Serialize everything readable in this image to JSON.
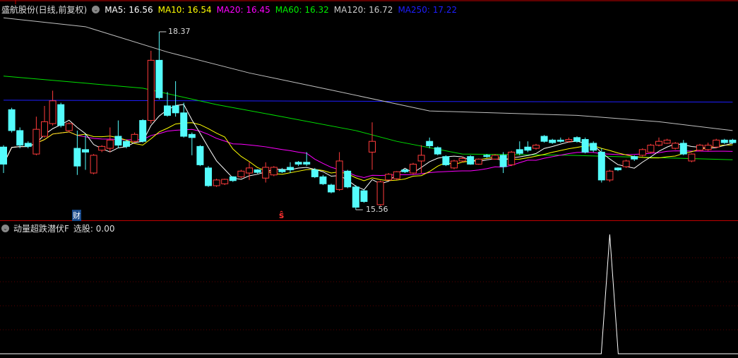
{
  "header": {
    "title": "盛航股份(日线,前复权)",
    "ma5": "MA5: 16.56",
    "ma10": "MA10: 16.54",
    "ma20": "MA20: 16.45",
    "ma60": "MA60: 16.32",
    "ma120": "MA120: 16.72",
    "ma250": "MA250: 17.22"
  },
  "indicator": {
    "name": "动量超跌潜伏F",
    "value_label": "选股: 0.00"
  },
  "markers": {
    "high_label": "18.37",
    "low_label": "15.56",
    "finance": "财",
    "sell": "ŝ"
  },
  "colors": {
    "up": "#ff3b3b",
    "down": "#54fcfc",
    "ma5": "#ffffff",
    "ma10": "#ffff00",
    "ma20": "#ff00ff",
    "ma60": "#00e000",
    "ma120": "#c0c0c0",
    "ma250": "#1e1eff",
    "divider": "#c00000"
  },
  "chart_data": [
    {
      "type": "candlestick",
      "title": "盛航股份(日线,前复权)",
      "ylim": [
        15.4,
        18.9
      ],
      "candles_ohlc_note": "[open, close, high, low]",
      "candles": [
        [
          16.55,
          16.28,
          16.58,
          16.14
        ],
        [
          17.14,
          16.81,
          17.17,
          16.78
        ],
        [
          16.81,
          16.58,
          16.86,
          16.53
        ],
        [
          16.61,
          16.56,
          16.64,
          16.53
        ],
        [
          16.44,
          16.83,
          17.03,
          16.42
        ],
        [
          16.72,
          16.95,
          17.2,
          16.7
        ],
        [
          16.92,
          17.28,
          17.44,
          16.89
        ],
        [
          17.22,
          16.89,
          17.25,
          16.86
        ],
        [
          16.81,
          16.92,
          16.94,
          16.78
        ],
        [
          16.53,
          16.25,
          16.81,
          16.11
        ],
        [
          16.51,
          16.47,
          16.75,
          16.19
        ],
        [
          16.14,
          16.42,
          16.44,
          16.12
        ],
        [
          16.5,
          16.56,
          16.58,
          16.47
        ],
        [
          16.53,
          16.66,
          16.86,
          16.47
        ],
        [
          16.72,
          16.58,
          16.97,
          16.53
        ],
        [
          16.64,
          16.56,
          16.66,
          16.53
        ],
        [
          16.64,
          16.75,
          16.78,
          16.62
        ],
        [
          16.97,
          16.64,
          16.99,
          16.62
        ],
        [
          16.97,
          17.92,
          18.07,
          16.92
        ],
        [
          17.92,
          17.33,
          18.37,
          17.3
        ],
        [
          17.2,
          17.05,
          17.42,
          17.03
        ],
        [
          17.2,
          17.09,
          17.59,
          17.03
        ],
        [
          17.09,
          16.72,
          17.25,
          16.7
        ],
        [
          16.75,
          16.7,
          16.78,
          16.42
        ],
        [
          16.56,
          16.27,
          16.58,
          16.25
        ],
        [
          16.22,
          15.94,
          16.25,
          15.92
        ],
        [
          15.94,
          16.03,
          16.05,
          15.92
        ],
        [
          15.97,
          16.04,
          16.05,
          15.95
        ],
        [
          16.08,
          16.02,
          16.09,
          16.0
        ],
        [
          16.08,
          16.17,
          16.19,
          16.06
        ],
        [
          16.14,
          16.22,
          16.31,
          16.03
        ],
        [
          16.19,
          16.15,
          16.2,
          16.13
        ],
        [
          16.06,
          16.23,
          16.31,
          15.99
        ],
        [
          16.11,
          16.23,
          16.25,
          16.09
        ],
        [
          16.19,
          16.16,
          16.22,
          16.14
        ],
        [
          16.23,
          16.19,
          16.31,
          16.14
        ],
        [
          16.31,
          16.28,
          16.33,
          16.25
        ],
        [
          16.31,
          16.28,
          16.47,
          16.25
        ],
        [
          16.19,
          16.08,
          16.22,
          16.06
        ],
        [
          16.08,
          15.97,
          16.11,
          15.95
        ],
        [
          15.95,
          15.84,
          15.97,
          15.82
        ],
        [
          15.88,
          16.33,
          16.47,
          15.86
        ],
        [
          16.17,
          15.92,
          16.19,
          15.9
        ],
        [
          15.92,
          15.6,
          15.95,
          15.56
        ],
        [
          15.86,
          15.69,
          15.88,
          15.67
        ],
        [
          16.47,
          16.64,
          16.94,
          16.19
        ],
        [
          15.64,
          16.0,
          16.02,
          15.62
        ],
        [
          16.03,
          16.12,
          16.14,
          16.02
        ],
        [
          16.05,
          16.16,
          16.17,
          16.03
        ],
        [
          16.19,
          16.16,
          16.2,
          16.14
        ],
        [
          16.14,
          16.28,
          16.3,
          16.12
        ],
        [
          16.33,
          16.42,
          16.58,
          16.14
        ],
        [
          16.64,
          16.57,
          16.7,
          16.53
        ],
        [
          16.54,
          16.44,
          16.56,
          16.42
        ],
        [
          16.4,
          16.27,
          16.42,
          16.25
        ],
        [
          16.22,
          16.33,
          16.35,
          16.2
        ],
        [
          16.33,
          16.37,
          16.4,
          16.31
        ],
        [
          16.4,
          16.28,
          16.42,
          16.27
        ],
        [
          16.28,
          16.36,
          16.37,
          16.27
        ],
        [
          16.42,
          16.4,
          16.44,
          16.38
        ],
        [
          16.36,
          16.42,
          16.44,
          16.35
        ],
        [
          16.42,
          16.24,
          16.47,
          16.14
        ],
        [
          16.27,
          16.47,
          16.49,
          16.25
        ],
        [
          16.51,
          16.45,
          16.64,
          16.42
        ],
        [
          16.55,
          16.5,
          16.64,
          16.47
        ],
        [
          16.53,
          16.58,
          16.6,
          16.51
        ],
        [
          16.72,
          16.64,
          16.74,
          16.62
        ],
        [
          16.66,
          16.62,
          16.68,
          16.6
        ],
        [
          16.66,
          16.64,
          16.7,
          16.62
        ],
        [
          16.64,
          16.67,
          16.7,
          16.62
        ],
        [
          16.7,
          16.64,
          16.72,
          16.62
        ],
        [
          16.67,
          16.47,
          16.7,
          16.45
        ],
        [
          16.61,
          16.5,
          16.64,
          16.47
        ],
        [
          16.47,
          16.03,
          16.53,
          15.99
        ],
        [
          16.03,
          16.17,
          16.19,
          16.0
        ],
        [
          16.22,
          16.19,
          16.23,
          16.17
        ],
        [
          16.24,
          16.33,
          16.35,
          16.22
        ],
        [
          16.4,
          16.36,
          16.42,
          16.33
        ],
        [
          16.42,
          16.51,
          16.53,
          16.4
        ],
        [
          16.47,
          16.58,
          16.6,
          16.45
        ],
        [
          16.58,
          16.64,
          16.7,
          16.56
        ],
        [
          16.61,
          16.66,
          16.68,
          16.6
        ],
        [
          16.53,
          16.61,
          16.63,
          16.51
        ],
        [
          16.61,
          16.44,
          16.66,
          16.42
        ],
        [
          16.33,
          16.44,
          16.45,
          16.31
        ],
        [
          16.5,
          16.58,
          16.6,
          16.48
        ],
        [
          16.51,
          16.58,
          16.62,
          16.49
        ],
        [
          16.55,
          16.66,
          16.68,
          16.53
        ],
        [
          16.66,
          16.62,
          16.68,
          16.6
        ],
        [
          16.66,
          16.62,
          16.68,
          16.6
        ]
      ],
      "ma60_points": [
        [
          0,
          17.67
        ],
        [
          17,
          17.48
        ],
        [
          26,
          17.22
        ],
        [
          34,
          17.03
        ],
        [
          43,
          16.81
        ],
        [
          48,
          16.64
        ],
        [
          56,
          16.44
        ],
        [
          69,
          16.42
        ],
        [
          89,
          16.35
        ]
      ],
      "ma120_points": [
        [
          0,
          18.59
        ],
        [
          10,
          18.45
        ],
        [
          20,
          18.05
        ],
        [
          30,
          17.72
        ],
        [
          40,
          17.45
        ],
        [
          52,
          17.12
        ],
        [
          70,
          17.05
        ],
        [
          80,
          16.95
        ],
        [
          89,
          16.81
        ]
      ],
      "ma250_points": [
        [
          0,
          17.29
        ],
        [
          50,
          17.27
        ],
        [
          89,
          17.26
        ]
      ],
      "high_point": {
        "index": 19,
        "value": 18.37
      },
      "low_point": {
        "index": 43,
        "value": 15.56
      },
      "finance_marker_index": 9,
      "sell_marker_index": 34
    },
    {
      "type": "line",
      "title": "动量超跌潜伏F",
      "ylim": [
        0,
        1
      ],
      "signal_index": 74,
      "signal_value": 1,
      "baseline": 0
    }
  ]
}
